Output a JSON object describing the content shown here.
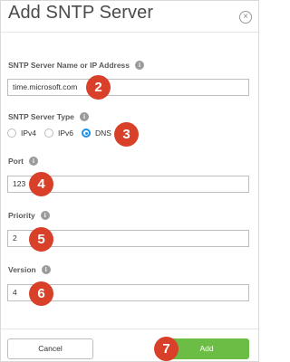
{
  "dialog": {
    "title": "Add SNTP Server",
    "close_glyph": "×"
  },
  "fields": {
    "server": {
      "label": "SNTP Server Name or IP Address",
      "value": "time.microsoft.com"
    },
    "type": {
      "label": "SNTP Server Type",
      "options": [
        "IPv4",
        "IPv6",
        "DNS"
      ],
      "selected": "DNS"
    },
    "port": {
      "label": "Port",
      "value": "123"
    },
    "priority": {
      "label": "Priority",
      "value": "2"
    },
    "version": {
      "label": "Version",
      "value": "4"
    }
  },
  "info_glyph": "i",
  "badges": [
    "2",
    "3",
    "4",
    "5",
    "6",
    "7"
  ],
  "buttons": {
    "cancel": "Cancel",
    "add": "Add"
  },
  "colors": {
    "badge": "#d8402a",
    "add_button": "#6bbd45",
    "radio_selected": "#1f8fe5"
  },
  "icons": {
    "close": "close-icon",
    "info": "info-icon"
  }
}
